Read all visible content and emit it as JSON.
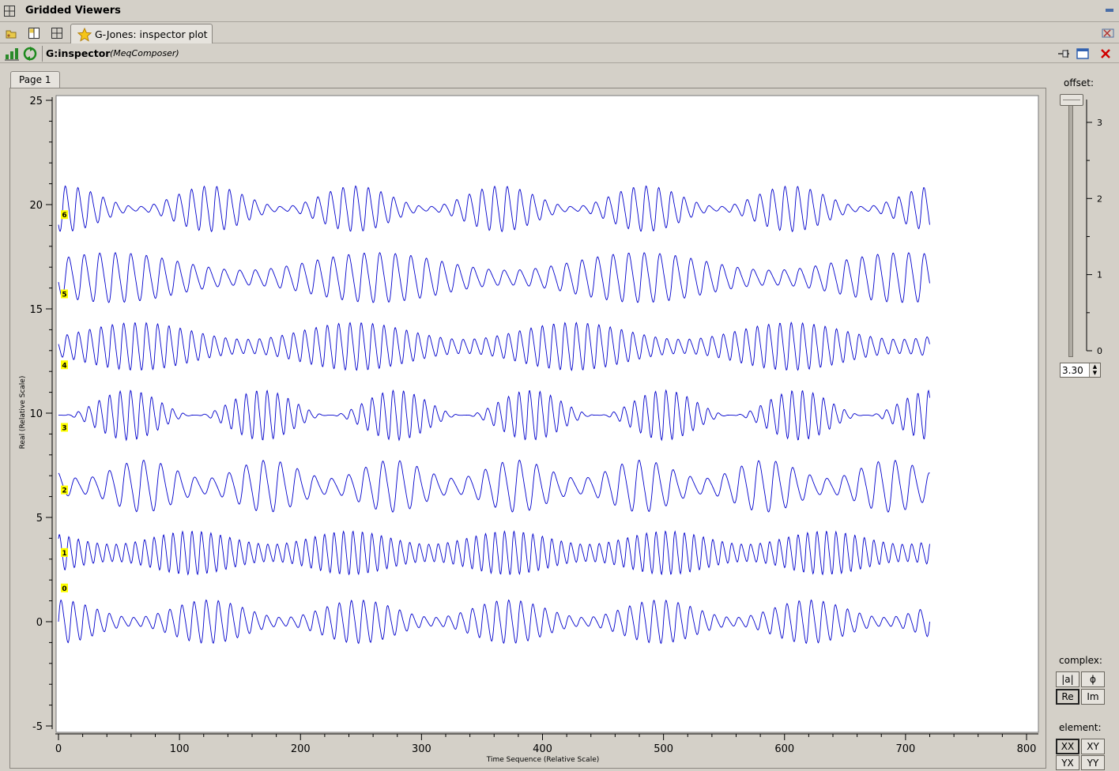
{
  "window": {
    "title": "Gridded Viewers"
  },
  "tabs": [
    {
      "label": "G-Jones: inspector plot",
      "active": true
    }
  ],
  "inspector": {
    "name": "G:inspector",
    "subtitle": "(MeqComposer)"
  },
  "page_tab": {
    "label": "Page 1"
  },
  "controls": {
    "offset_label": "offset:",
    "offset_value": "3.30",
    "offset_scale_ticks": [
      "3",
      "2",
      "1",
      "0"
    ],
    "offset_range": [
      0,
      3.3
    ],
    "complex_label": "complex:",
    "complex_buttons": [
      "|a|",
      "ϕ",
      "Re",
      "Im"
    ],
    "complex_selected": "Re",
    "element_label": "element:",
    "element_buttons": [
      "XX",
      "XY",
      "YX",
      "YY"
    ],
    "element_selected": "XX"
  },
  "icons": {
    "window": "grid-icon",
    "minimize": "minimize-icon",
    "tab_bar_left": [
      "folder-icon",
      "layout-icon",
      "grid-icon"
    ],
    "tab": "star-icon",
    "tab_bar_right": "close-tabs-icon",
    "inspector_left": [
      "tree-icon",
      "refresh-icon"
    ],
    "inspector_right": [
      "pin-icon",
      "detach-icon",
      "close-icon"
    ]
  },
  "colors": {
    "series": "#0000cc",
    "label_bg": "#ffff00",
    "plot_bg": "#ffffff"
  },
  "chart_data": {
    "type": "line",
    "xlabel": "Time Sequence (Relative Scale)",
    "ylabel": "Real (Relative Scale)",
    "xlim": [
      0,
      800
    ],
    "ylim": [
      -5,
      25
    ],
    "x_ticks": [
      0,
      100,
      200,
      300,
      400,
      500,
      600,
      700,
      800
    ],
    "y_ticks": [
      -5,
      0,
      5,
      10,
      15,
      20,
      25
    ],
    "x_range_data": [
      0,
      720
    ],
    "series": [
      {
        "name": "0",
        "label_y": 1.6,
        "baseline": 0.0,
        "amplitude": 1.0,
        "cycles": 72,
        "mod_amp": 0.4,
        "mod_cycles": 5.8
      },
      {
        "name": "1",
        "label_y": 3.3,
        "baseline": 3.3,
        "amplitude": 1.0,
        "cycles": 92,
        "mod_amp": 0.3,
        "mod_cycles": 5.5
      },
      {
        "name": "2",
        "label_y": 6.3,
        "baseline": 6.5,
        "amplitude": 1.2,
        "cycles": 51,
        "mod_amp": 0.35,
        "mod_cycles": 7.0
      },
      {
        "name": "3",
        "label_y": 9.3,
        "baseline": 9.9,
        "amplitude": 1.15,
        "cycles": 83,
        "mod_amp": 0.5,
        "mod_cycles": 6.5
      },
      {
        "name": "4",
        "label_y": 12.3,
        "baseline": 13.2,
        "amplitude": 1.1,
        "cycles": 77,
        "mod_amp": 0.35,
        "mod_cycles": 4.0
      },
      {
        "name": "5",
        "label_y": 15.7,
        "baseline": 16.5,
        "amplitude": 1.15,
        "cycles": 56,
        "mod_amp": 0.35,
        "mod_cycles": 3.3
      },
      {
        "name": "6",
        "label_y": 19.5,
        "baseline": 19.8,
        "amplitude": 1.05,
        "cycles": 69,
        "mod_amp": 0.45,
        "mod_cycles": 6.0
      }
    ]
  }
}
